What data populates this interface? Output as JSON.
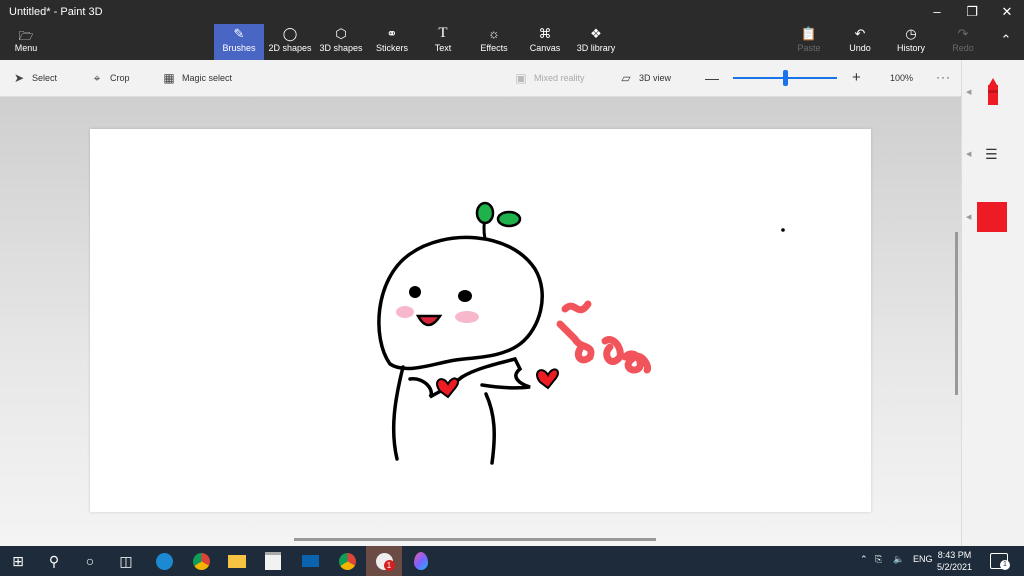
{
  "window": {
    "title": "Untitled* - Paint 3D"
  },
  "ribbon": {
    "menu_label": "Menu",
    "tabs": [
      {
        "label": "Brushes",
        "icon": "brush-icon",
        "active": true
      },
      {
        "label": "2D shapes",
        "icon": "2d-shapes-icon"
      },
      {
        "label": "3D shapes",
        "icon": "3d-shapes-icon"
      },
      {
        "label": "Stickers",
        "icon": "stickers-icon"
      },
      {
        "label": "Text",
        "icon": "text-icon"
      },
      {
        "label": "Effects",
        "icon": "effects-icon"
      },
      {
        "label": "Canvas",
        "icon": "canvas-icon"
      },
      {
        "label": "3D library",
        "icon": "3d-library-icon"
      }
    ],
    "actions": [
      {
        "label": "Paste",
        "icon": "paste-icon",
        "disabled": true
      },
      {
        "label": "Undo",
        "icon": "undo-icon"
      },
      {
        "label": "History",
        "icon": "history-icon"
      },
      {
        "label": "Redo",
        "icon": "redo-icon",
        "disabled": true
      }
    ]
  },
  "toolbar": {
    "select_label": "Select",
    "crop_label": "Crop",
    "magic_select_label": "Magic select",
    "mixed_reality_label": "Mixed reality",
    "view_3d_label": "3D view",
    "zoom_value": "100%",
    "zoom_level": 0.5
  },
  "side_panel": {
    "active_color": "#ed1c24"
  },
  "taskbar": {
    "apps": [
      "windows-start-icon",
      "search-icon",
      "cortana-icon",
      "task-view-icon",
      "edge-icon",
      "chrome-profile-icon",
      "file-explorer-icon",
      "store-icon",
      "mail-icon",
      "chrome-icon",
      "app-badge-icon",
      "paint-3d-icon"
    ],
    "language": "ENG",
    "time": "8:43 PM",
    "date": "5/2/2021",
    "notification_count": "1",
    "app_badge_count": "1"
  },
  "colors": {
    "accent": "#4a66c4",
    "titlebar": "#2b2b2b",
    "taskbar": "#1d2b3a",
    "brush_red": "#ed1c24"
  }
}
